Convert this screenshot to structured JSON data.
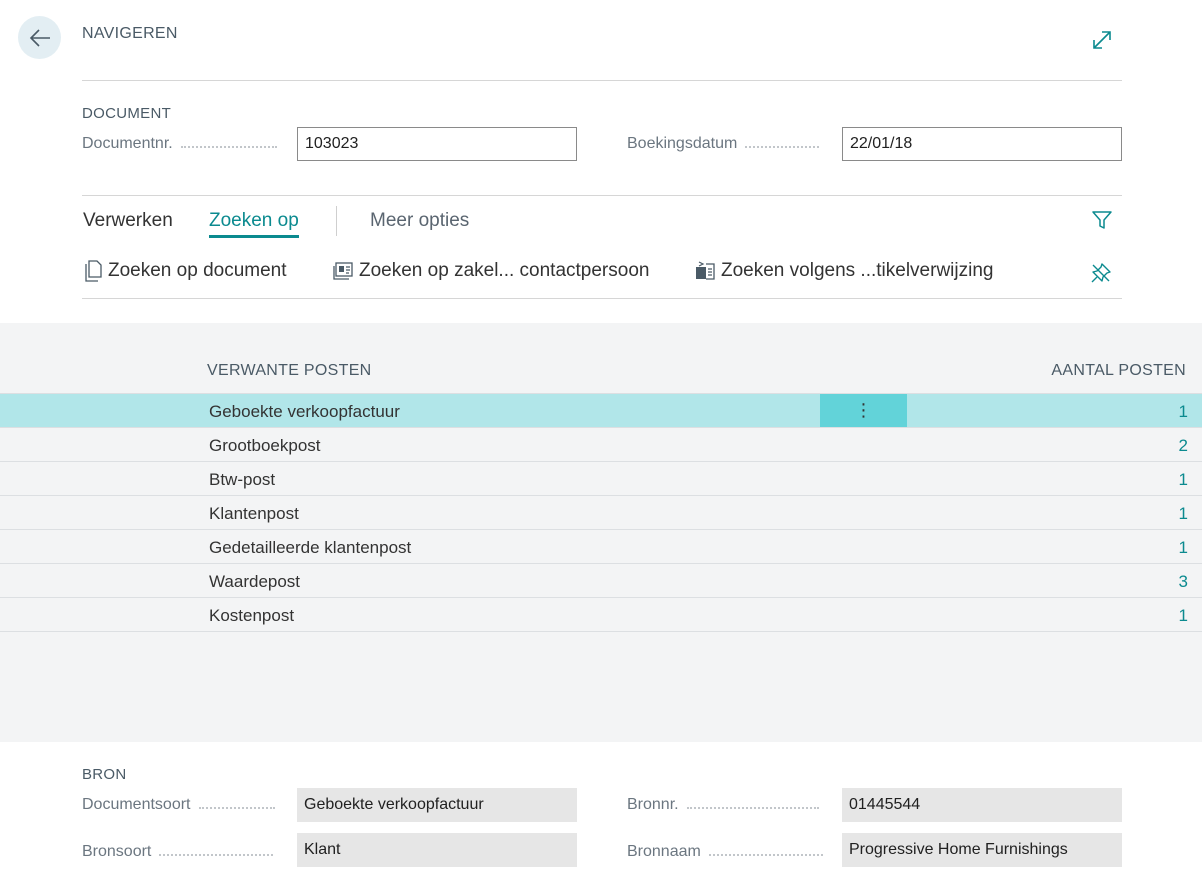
{
  "header": {
    "back_icon": "arrow-left-icon",
    "caption": "NAVIGEREN",
    "expand_icon": "expand-icon"
  },
  "document": {
    "title": "DOCUMENT",
    "doc_no_label": "Documentnr.",
    "doc_no_value": "103023",
    "posting_date_label": "Boekingsdatum",
    "posting_date_value": "22/01/18"
  },
  "tabs": [
    {
      "label": "Verwerken"
    },
    {
      "label": "Zoeken op"
    },
    {
      "label": "Meer opties"
    }
  ],
  "actions": [
    {
      "label": "Zoeken op document",
      "icon": "document-icon"
    },
    {
      "label": "Zoeken op zakel... contactpersoon",
      "icon": "contact-card-icon"
    },
    {
      "label": "Zoeken volgens ...tikelverwijzing",
      "icon": "item-reference-icon"
    }
  ],
  "toolbar_icons": {
    "filter": "filter-icon",
    "pin": "pin-icon"
  },
  "list": {
    "col_name": "VERWANTE POSTEN",
    "col_count": "AANTAL POSTEN",
    "more_glyph": "⋮",
    "rows": [
      {
        "name": "Geboekte verkoopfactuur",
        "count": "1",
        "selected": true
      },
      {
        "name": "Grootboekpost",
        "count": "2"
      },
      {
        "name": "Btw-post",
        "count": "1"
      },
      {
        "name": "Klantenpost",
        "count": "1"
      },
      {
        "name": "Gedetailleerde klantenpost",
        "count": "1"
      },
      {
        "name": "Waardepost",
        "count": "3"
      },
      {
        "name": "Kostenpost",
        "count": "1"
      }
    ]
  },
  "source": {
    "title": "BRON",
    "doc_type_label": "Documentsoort",
    "doc_type_value": "Geboekte verkoopfactuur",
    "source_type_label": "Bronsoort",
    "source_type_value": "Klant",
    "source_no_label": "Bronnr.",
    "source_no_value": "01445544",
    "source_name_label": "Bronnaam",
    "source_name_value": "Progressive Home Furnishings"
  },
  "colors": {
    "accent": "#0b8a8f",
    "selected_row": "#b1e6e9",
    "row_menu": "#62d3d9"
  }
}
